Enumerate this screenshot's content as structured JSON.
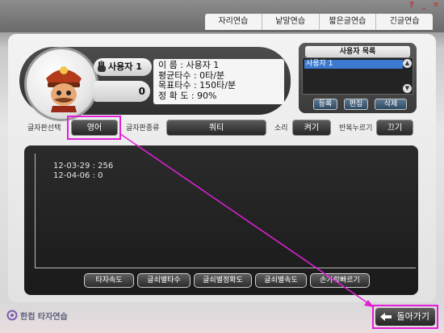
{
  "window": {
    "controls": [
      {
        "icon": "help-icon",
        "glyph": "?"
      },
      {
        "icon": "minimize-icon",
        "glyph": "_"
      },
      {
        "icon": "close-icon",
        "glyph": "✕"
      }
    ]
  },
  "mode_tabs": [
    "자리연습",
    "낱말연습",
    "짧은글연습",
    "긴글연습"
  ],
  "profile": {
    "name_badge": "사용자 1",
    "count": "0",
    "stats": [
      "이    름 : 사용자 1",
      "평균타수 : 0타/분",
      "목표타수 : 150타/분",
      "정 확 도 : 90%"
    ]
  },
  "user_list": {
    "title": "사용자 목록",
    "users": [
      "사용자 1"
    ],
    "buttons": [
      "등록",
      "편집",
      "삭제"
    ]
  },
  "options": {
    "keyboard_select_label": "글자판선택",
    "keyboard_select_value": "영어",
    "keyboard_type_label": "글자판종류",
    "keyboard_type_value": "쿼티",
    "sound_label": "소리",
    "sound_value": "켜기",
    "repeat_label": "반복누르기",
    "repeat_value": "끄기"
  },
  "history": {
    "records": [
      "12-03-29 : 256",
      "12-04-06 : 0"
    ]
  },
  "stat_tabs": [
    "타자속도",
    "글쇠별타수",
    "글쇠별정확도",
    "글쇠별속도",
    "손가락빠르기"
  ],
  "footer": {
    "logo_text": "한컴 타자연습",
    "back_label": "돌아가기"
  },
  "colors": {
    "highlight": "#e21fd9",
    "selection": "#3b7ad0",
    "dark_panel": "#1a1a1a"
  }
}
